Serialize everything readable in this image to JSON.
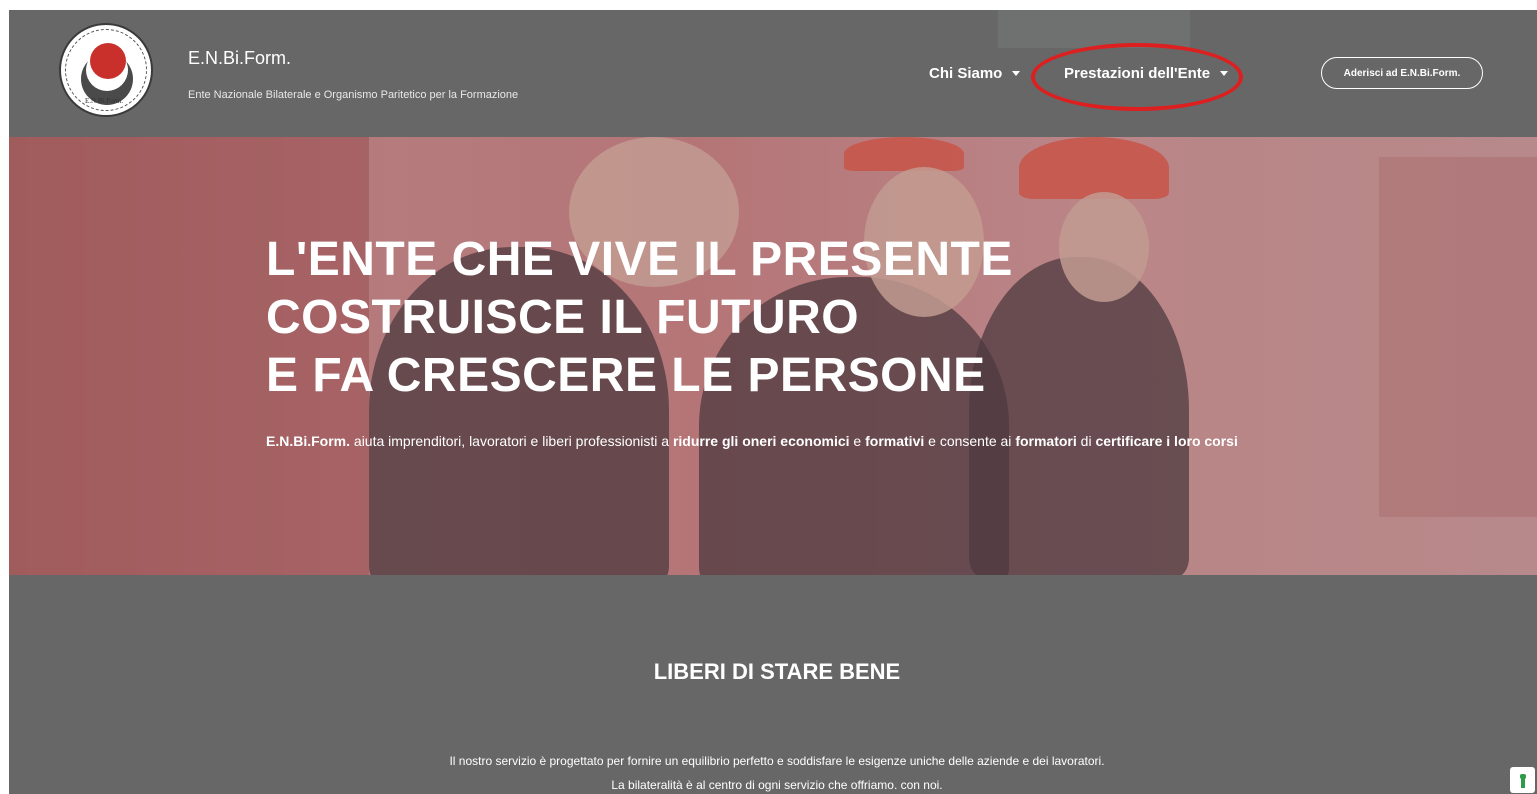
{
  "header": {
    "brand_name": "E.N.Bi.Form.",
    "brand_tagline": "Ente Nazionale Bilaterale e Organismo Paritetico per la Formazione",
    "logo_text": "E.N.Bi.Form.",
    "nav": [
      {
        "label": "Chi Siamo",
        "icon": "chevron-down-icon"
      },
      {
        "label": "Prestazioni dell'Ente",
        "icon": "chevron-down-icon"
      }
    ],
    "join_button": "Aderisci ad E.N.Bi.Form."
  },
  "hero": {
    "title_lines": [
      "L'ENTE CHE VIVE IL PRESENTE",
      "COSTRUISCE IL FUTURO",
      "E FA CRESCERE LE PERSONE"
    ],
    "text": {
      "p1": "E.N.Bi.Form.",
      "p2": " aiuta imprenditori, lavoratori e liberi professionisti a ",
      "p3": "ridurre gli oneri economici",
      "p4": " e ",
      "p5": "formativi",
      "p6": " e consente ai ",
      "p7": "formatori",
      "p8": " di ",
      "p9": "certificare i loro corsi"
    }
  },
  "section": {
    "title": "LIBERI DI STARE BENE",
    "lines": [
      "Il nostro servizio è progettato per fornire un equilibrio perfetto e soddisfare le esigenze uniche delle aziende e dei lavoratori.",
      "La bilateralità è al centro di ogni servizio che offriamo. con noi."
    ]
  },
  "colors": {
    "page_bg": "#676767",
    "hero_overlay": "#b57b7d",
    "highlight_oval": "#dd1f1f",
    "logo_red": "#c9302c"
  }
}
